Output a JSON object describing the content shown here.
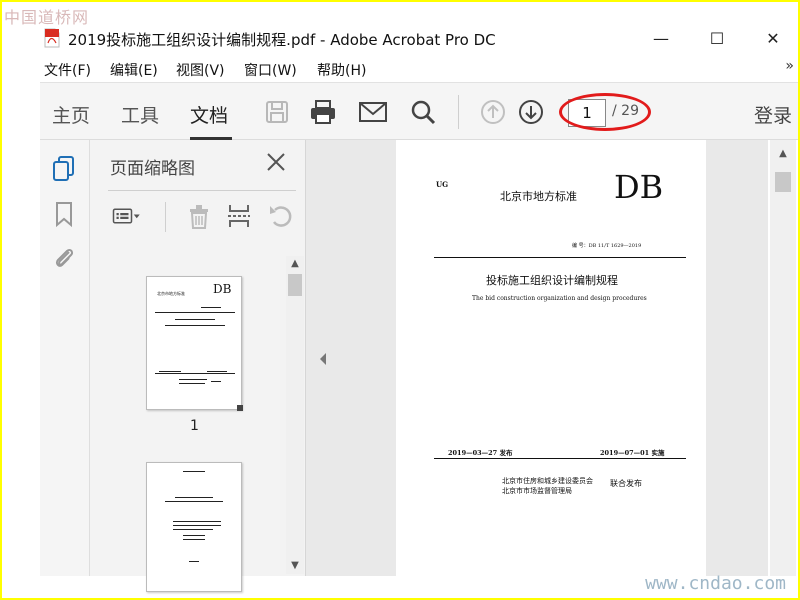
{
  "watermark_top": "中国道桥网",
  "watermark_bottom": "www.cndao.com",
  "window": {
    "title": "2019投标施工组织设计编制规程.pdf - Adobe Acrobat Pro DC",
    "minimize": "—",
    "maximize": "☐",
    "close": "✕"
  },
  "menu": {
    "items": [
      "文件(F)",
      "编辑(E)",
      "视图(V)",
      "窗口(W)",
      "帮助(H)"
    ],
    "more": "»"
  },
  "toolbar": {
    "tabs": [
      "主页",
      "工具",
      "文档"
    ],
    "active_tab": "文档",
    "current_page": "1",
    "total_pages": "/ 29",
    "login": "登录",
    "icons": [
      "save-icon",
      "print-icon",
      "email-icon",
      "search-icon",
      "page-up-icon",
      "page-down-icon"
    ],
    "highlight_color": "#e21b1b"
  },
  "left_rail": {
    "icons": [
      "pages-icon",
      "bookmark-icon",
      "attachment-icon"
    ],
    "accent": "#1f6fb5"
  },
  "thumbnail_panel": {
    "title": "页面缩略图",
    "tool_icons": [
      "options-icon",
      "delete-icon",
      "insert-page-icon",
      "rotate-icon"
    ],
    "thumbnails": [
      {
        "label": "1",
        "db": "DB",
        "issuer": "北京市地方标准"
      },
      {
        "label": "",
        "db": "",
        "issuer": ""
      }
    ]
  },
  "document": {
    "ug": "UG",
    "standard_name": "北京市地方标准",
    "db": "DB",
    "code": "编  号：DB 11/T 1629—2019",
    "title": "投标施工组织设计编制规程",
    "english_title": "The bid construction organization and design procedures",
    "publish_date": "2019—03—27 发布",
    "effective_date": "2019—07—01 实施",
    "issuer_1": "北京市住房和城乡建设委员会",
    "issuer_2": "北京市市场监督管理局",
    "release": "联合发布"
  }
}
